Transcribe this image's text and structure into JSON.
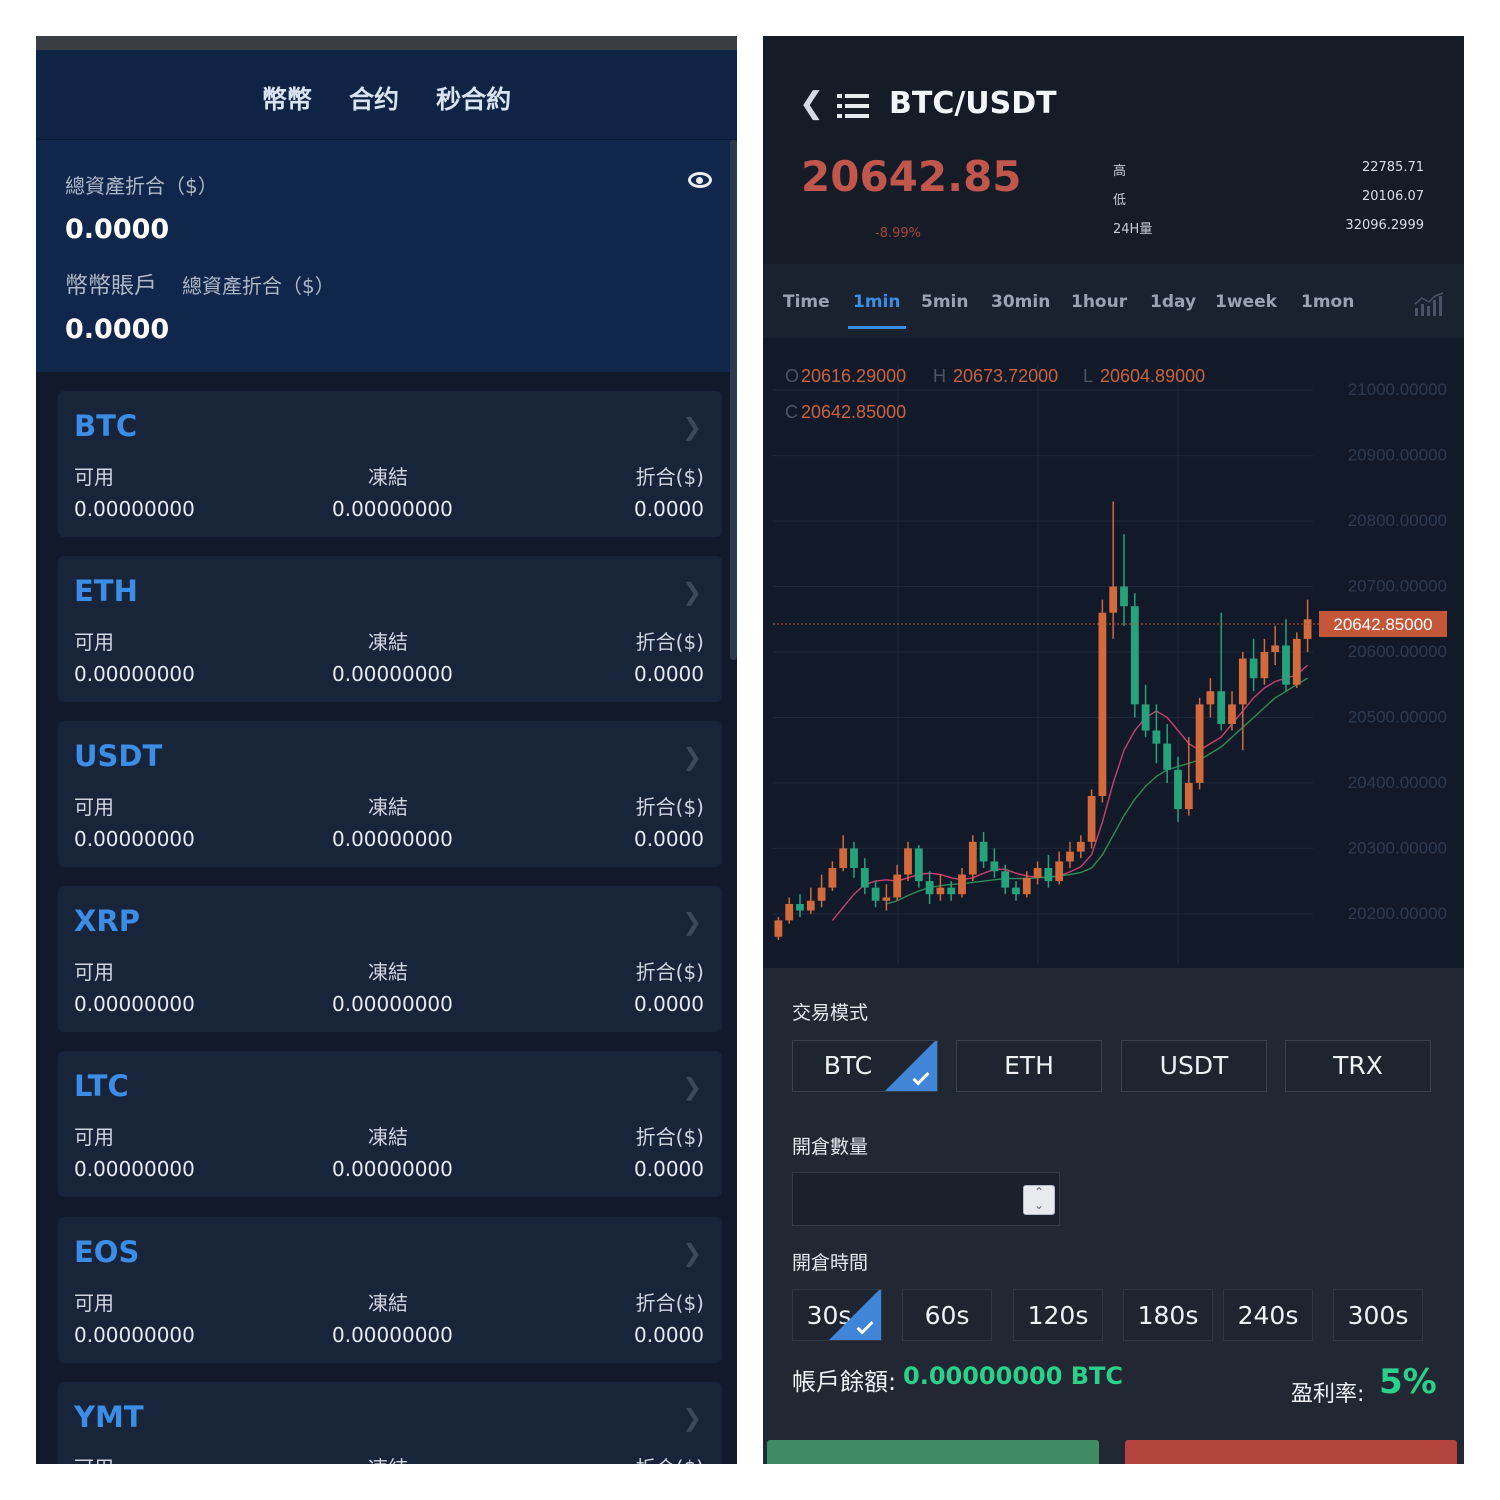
{
  "left": {
    "tabs": [
      "幣幣",
      "合约",
      "秒合約"
    ],
    "total_label": "總資產折合（$）",
    "total_value": "0.0000",
    "account_label": "幣幣賬戶",
    "account_total_label": "總資產折合（$）",
    "account_value": "0.0000",
    "col_labels": {
      "available": "可用",
      "frozen": "凍結",
      "converted": "折合($)"
    },
    "assets": [
      {
        "coin": "BTC",
        "available": "0.00000000",
        "frozen": "0.00000000",
        "converted": "0.0000"
      },
      {
        "coin": "ETH",
        "available": "0.00000000",
        "frozen": "0.00000000",
        "converted": "0.0000"
      },
      {
        "coin": "USDT",
        "available": "0.00000000",
        "frozen": "0.00000000",
        "converted": "0.0000"
      },
      {
        "coin": "XRP",
        "available": "0.00000000",
        "frozen": "0.00000000",
        "converted": "0.0000"
      },
      {
        "coin": "LTC",
        "available": "0.00000000",
        "frozen": "0.00000000",
        "converted": "0.0000"
      },
      {
        "coin": "EOS",
        "available": "0.00000000",
        "frozen": "0.00000000",
        "converted": "0.0000"
      },
      {
        "coin": "YMT",
        "available": "",
        "frozen": "",
        "converted": ""
      }
    ]
  },
  "right": {
    "pair": "BTC/USDT",
    "price": "20642.85",
    "change_pct": "-8.99%",
    "stats": [
      {
        "label": "高",
        "value": "22785.71"
      },
      {
        "label": "低",
        "value": "20106.07"
      },
      {
        "label": "24H量",
        "value": "32096.2999"
      }
    ],
    "timeframes": [
      "Time",
      "1min",
      "5min",
      "30min",
      "1hour",
      "1day",
      "1week",
      "1mon"
    ],
    "active_timeframe": "1min",
    "ohlc": {
      "o_label": "O",
      "o": "20616.29000",
      "h_label": "H",
      "h": "20673.72000",
      "l_label": "L",
      "l": "20604.89000",
      "c_label": "C",
      "c": "20642.85000"
    },
    "price_tag": "20642.85000",
    "trade_mode_label": "交易模式",
    "modes": [
      "BTC",
      "ETH",
      "USDT",
      "TRX"
    ],
    "selected_mode": "BTC",
    "qty_label": "開倉數量",
    "qty_value": "",
    "time_label": "開倉時間",
    "times": [
      "30s",
      "60s",
      "120s",
      "180s",
      "240s",
      "300s"
    ],
    "selected_time": "30s",
    "balance_label": "帳戶餘額:",
    "balance_value": "0.00000000 BTC",
    "rate_label": "盈利率:",
    "rate_value": "5%"
  },
  "colors": {
    "up": "#26a27c",
    "down": "#d36a3c",
    "accent": "#3b8de6",
    "profit": "#2bd08a"
  },
  "chart_data": {
    "type": "candlestick",
    "ylim": [
      20160,
      21040
    ],
    "y_ticks": [
      "21000.00000",
      "20900.00000",
      "20800.00000",
      "20700.00000",
      "20600.00000",
      "20500.00000",
      "20400.00000",
      "20300.00000",
      "20200.00000"
    ],
    "last_price": 20642.85,
    "candles": [
      [
        20165,
        20190,
        20160,
        20195
      ],
      [
        20190,
        20215,
        20185,
        20225
      ],
      [
        20215,
        20205,
        20195,
        20230
      ],
      [
        20205,
        20220,
        20200,
        20240
      ],
      [
        20220,
        20240,
        20210,
        20260
      ],
      [
        20240,
        20270,
        20235,
        20280
      ],
      [
        20270,
        20300,
        20265,
        20320
      ],
      [
        20300,
        20270,
        20255,
        20310
      ],
      [
        20270,
        20240,
        20230,
        20285
      ],
      [
        20240,
        20220,
        20210,
        20250
      ],
      [
        20220,
        20225,
        20205,
        20245
      ],
      [
        20225,
        20260,
        20220,
        20275
      ],
      [
        20260,
        20300,
        20250,
        20310
      ],
      [
        20300,
        20250,
        20240,
        20305
      ],
      [
        20250,
        20230,
        20215,
        20265
      ],
      [
        20230,
        20240,
        20220,
        20260
      ],
      [
        20240,
        20230,
        20220,
        20250
      ],
      [
        20230,
        20260,
        20225,
        20270
      ],
      [
        20260,
        20310,
        20250,
        20320
      ],
      [
        20310,
        20280,
        20270,
        20325
      ],
      [
        20280,
        20265,
        20255,
        20300
      ],
      [
        20265,
        20240,
        20230,
        20275
      ],
      [
        20240,
        20230,
        20220,
        20250
      ],
      [
        20230,
        20255,
        20225,
        20265
      ],
      [
        20255,
        20270,
        20245,
        20280
      ],
      [
        20270,
        20250,
        20240,
        20290
      ],
      [
        20250,
        20280,
        20245,
        20295
      ],
      [
        20280,
        20295,
        20270,
        20310
      ],
      [
        20295,
        20310,
        20285,
        20320
      ],
      [
        20310,
        20380,
        20300,
        20390
      ],
      [
        20380,
        20660,
        20370,
        20680
      ],
      [
        20660,
        20700,
        20620,
        20830
      ],
      [
        20700,
        20670,
        20640,
        20780
      ],
      [
        20670,
        20520,
        20500,
        20690
      ],
      [
        20520,
        20480,
        20470,
        20550
      ],
      [
        20480,
        20460,
        20430,
        20520
      ],
      [
        20460,
        20420,
        20400,
        20490
      ],
      [
        20420,
        20360,
        20340,
        20440
      ],
      [
        20360,
        20400,
        20350,
        20470
      ],
      [
        20400,
        20520,
        20390,
        20530
      ],
      [
        20520,
        20540,
        20500,
        20560
      ],
      [
        20540,
        20490,
        20480,
        20660
      ],
      [
        20490,
        20520,
        20480,
        20540
      ],
      [
        20520,
        20590,
        20450,
        20600
      ],
      [
        20590,
        20560,
        20540,
        20620
      ],
      [
        20560,
        20600,
        20550,
        20620
      ],
      [
        20600,
        20610,
        20580,
        20640
      ],
      [
        20610,
        20550,
        20540,
        20650
      ],
      [
        20550,
        20620,
        20545,
        20630
      ],
      [
        20620,
        20650,
        20600,
        20680
      ]
    ],
    "ma_series": [
      {
        "name": "ma-short",
        "color": "#c6416e",
        "values": [
          null,
          null,
          null,
          null,
          null,
          20190,
          20210,
          20230,
          20245,
          20250,
          20252,
          20250,
          20255,
          20260,
          20262,
          20260,
          20255,
          20252,
          20255,
          20262,
          20268,
          20268,
          20262,
          20258,
          20256,
          20256,
          20258,
          20264,
          20272,
          20290,
          20340,
          20400,
          20450,
          20480,
          20500,
          20510,
          20500,
          20480,
          20460,
          20450,
          20460,
          20470,
          20490,
          20510,
          20530,
          20545,
          20555,
          20560,
          20565,
          20580
        ]
      },
      {
        "name": "ma-long",
        "color": "#2f8a57",
        "values": [
          null,
          null,
          null,
          null,
          null,
          null,
          null,
          null,
          null,
          null,
          20215,
          20220,
          20228,
          20235,
          20240,
          20243,
          20245,
          20246,
          20248,
          20250,
          20252,
          20254,
          20254,
          20254,
          20255,
          20256,
          20258,
          20260,
          20263,
          20270,
          20290,
          20320,
          20350,
          20375,
          20395,
          20410,
          20420,
          20425,
          20430,
          20435,
          20445,
          20455,
          20470,
          20485,
          20500,
          20515,
          20530,
          20540,
          20550,
          20560
        ]
      }
    ]
  }
}
